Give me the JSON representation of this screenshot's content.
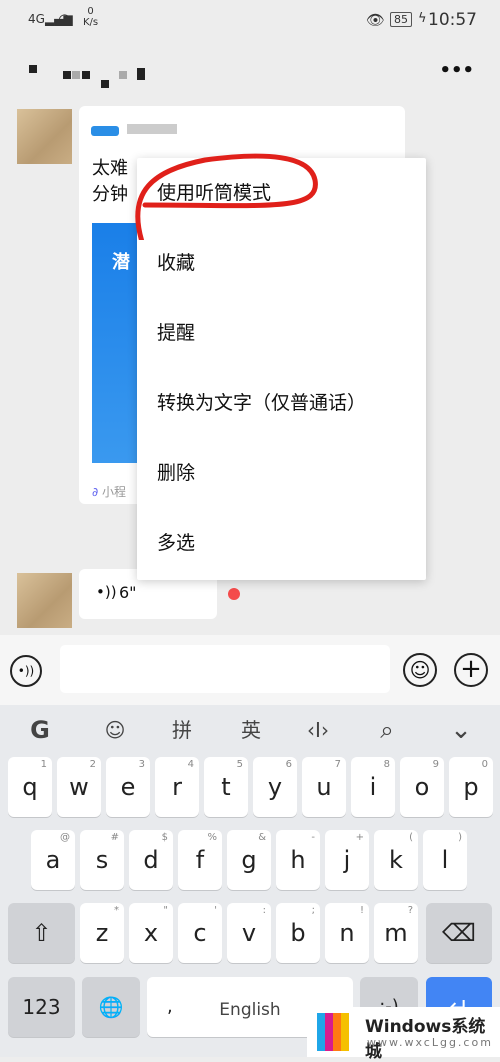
{
  "status": {
    "network": "4G",
    "speed_value": "0",
    "speed_unit": "K/s",
    "battery": "85",
    "time": "10:57"
  },
  "header": {
    "more_label": "•••"
  },
  "chat": {
    "card_text_line1": "太难",
    "card_text_line2": "分钟",
    "card_banner_text": "潜",
    "card_footer": "小程",
    "voice_duration": "6\""
  },
  "menu": {
    "items": [
      {
        "label": "使用听筒模式"
      },
      {
        "label": "收藏"
      },
      {
        "label": "提醒"
      },
      {
        "label": "转换为文字（仅普通话）"
      },
      {
        "label": "删除"
      },
      {
        "label": "多选"
      }
    ],
    "highlight_color": "#e0201a"
  },
  "keyboard": {
    "toolbar": {
      "g": "G",
      "emoji": "☺",
      "pinyin": "拼",
      "english": "英",
      "cursor": "‹I›",
      "search": "⌕",
      "collapse": "⌄"
    },
    "row1": [
      {
        "k": "q",
        "h": "1"
      },
      {
        "k": "w",
        "h": "2"
      },
      {
        "k": "e",
        "h": "3"
      },
      {
        "k": "r",
        "h": "4"
      },
      {
        "k": "t",
        "h": "5"
      },
      {
        "k": "y",
        "h": "6"
      },
      {
        "k": "u",
        "h": "7"
      },
      {
        "k": "i",
        "h": "8"
      },
      {
        "k": "o",
        "h": "9"
      },
      {
        "k": "p",
        "h": "0"
      }
    ],
    "row2": [
      {
        "k": "a",
        "h": "@"
      },
      {
        "k": "s",
        "h": "#"
      },
      {
        "k": "d",
        "h": "$"
      },
      {
        "k": "f",
        "h": "%"
      },
      {
        "k": "g",
        "h": "&"
      },
      {
        "k": "h",
        "h": "-"
      },
      {
        "k": "j",
        "h": "+"
      },
      {
        "k": "k",
        "h": "("
      },
      {
        "k": "l",
        "h": ")"
      }
    ],
    "row3": [
      {
        "k": "z",
        "h": "*"
      },
      {
        "k": "x",
        "h": "\""
      },
      {
        "k": "c",
        "h": "'"
      },
      {
        "k": "v",
        "h": ":"
      },
      {
        "k": "b",
        "h": ";"
      },
      {
        "k": "n",
        "h": "!"
      },
      {
        "k": "m",
        "h": "?"
      }
    ],
    "shift": "⇧",
    "backspace": "⌫",
    "num": "123",
    "globe": "🌐",
    "comma": ",",
    "space": "English",
    "smiley": ":-)",
    "enter": "↵",
    "enter_color": "#4285f4"
  },
  "watermark": {
    "title": "Windows系统城",
    "url": "www.wxcLgg.com"
  }
}
